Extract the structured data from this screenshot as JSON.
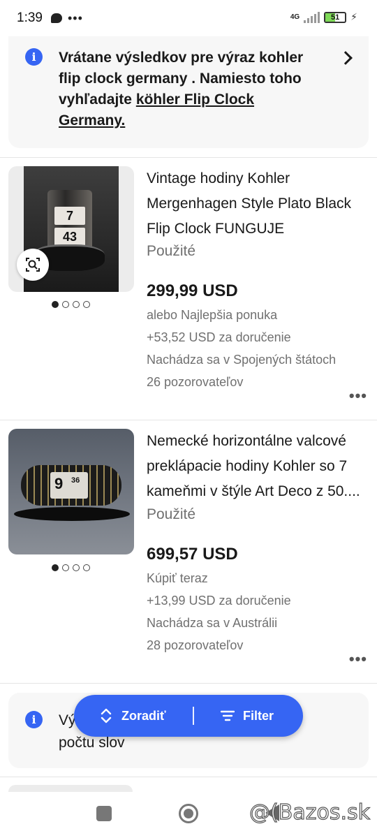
{
  "status_bar": {
    "time": "1:39",
    "network": "4G",
    "battery": "51",
    "icons": [
      "chat-icon",
      "more-dots-icon",
      "signal-icon",
      "battery-icon",
      "charging-bolt-icon"
    ]
  },
  "banner": {
    "text_prefix": "Vrátane výsledkov pre výraz kohler flip clock germany . Namiesto toho vyhľadajte ",
    "link": "köhler Flip Clock Germany.",
    "icon": "info-icon"
  },
  "listings": [
    {
      "title": "Vintage hodiny Kohler Mergenhagen Style Plato Black Flip Clock FUNGUJE",
      "condition": "Použité",
      "price": "299,99 USD",
      "offer": "alebo Najlepšia ponuka",
      "shipping": "+53,52 USD za doručenie",
      "location": "Nachádza sa v Spojených štátoch",
      "watchers": "26 pozorovateľov",
      "image_digits": [
        "7",
        "43"
      ],
      "image_count": 4,
      "active_image": 1
    },
    {
      "title": "Nemecké horizontálne valcové preklápacie hodiny Kohler so 7 kameňmi v štýle Art Deco z 50....",
      "condition": "Použité",
      "price": "699,57 USD",
      "offer": "Kúpiť teraz",
      "shipping": "+13,99 USD za doručenie",
      "location": "Nachádza sa v Austrálii",
      "watchers": "28 pozorovateľov",
      "image_digits": [
        "9",
        "36"
      ],
      "image_count": 4,
      "active_image": 1
    }
  ],
  "banner2": {
    "text_line1": "Vý",
    "text_line2": "počtu slov",
    "icon": "info-icon"
  },
  "sort_filter": {
    "sort_label": "Zoradiť",
    "filter_label": "Filter"
  },
  "nav": {
    "watermark": "@(Bazos.sk"
  },
  "colors": {
    "accent": "#3665f3",
    "text": "#191919",
    "secondary_text": "#707070",
    "banner_bg": "#f7f7f7"
  }
}
